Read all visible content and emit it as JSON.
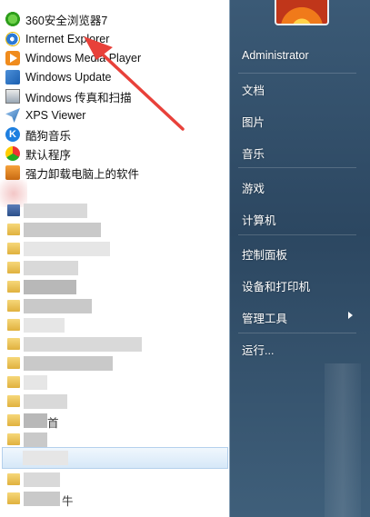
{
  "programs": [
    {
      "label": "360安全浏览器7",
      "icon": "browser-360-icon"
    },
    {
      "label": "Internet Explorer",
      "icon": "internet-explorer-icon"
    },
    {
      "label": "Windows Media Player",
      "icon": "media-player-icon"
    },
    {
      "label": "Windows Update",
      "icon": "windows-update-icon"
    },
    {
      "label": "Windows 传真和扫描",
      "icon": "fax-scan-icon"
    },
    {
      "label": "XPS Viewer",
      "icon": "xps-viewer-icon"
    },
    {
      "label": "酷狗音乐",
      "icon": "kugou-music-icon"
    },
    {
      "label": "默认程序",
      "icon": "default-programs-icon"
    },
    {
      "label": "强力卸载电脑上的软件",
      "icon": "uninstaller-icon"
    }
  ],
  "blurred_fragments": {
    "frag1": "首",
    "frag2": "牛"
  },
  "user": {
    "name": "Administrator"
  },
  "places": {
    "documents": "文档",
    "pictures": "图片",
    "music": "音乐",
    "games": "游戏",
    "computer": "计算机",
    "control_panel": "控制面板",
    "devices_printers": "设备和打印机",
    "admin_tools": "管理工具",
    "run": "运行..."
  },
  "colors": {
    "annotation_arrow": "#e8413a",
    "places_panel": "#2f4b62"
  }
}
